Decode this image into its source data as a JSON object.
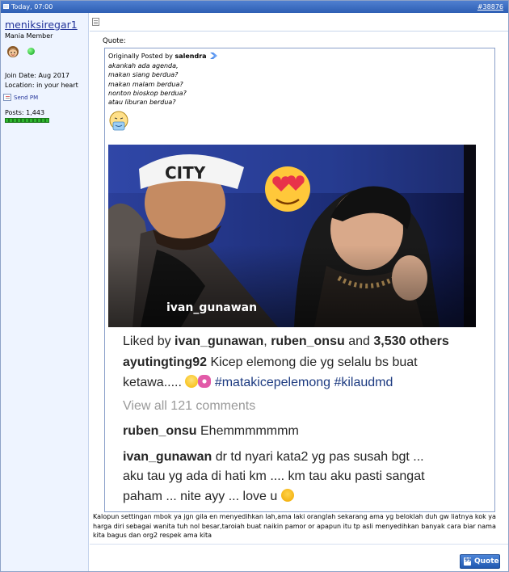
{
  "header": {
    "date": "Today, 07:00",
    "post_number": "#38876"
  },
  "user": {
    "name": "meniksiregar1",
    "title": "Mania Member",
    "join_date": "Join Date: Aug 2017",
    "location": "Location: in your heart",
    "send_pm": "Send PM",
    "posts": "Posts: 1,443",
    "reputation_pips": 11
  },
  "quote": {
    "label": "Quote:",
    "originally_posted_by": "Originally Posted by",
    "author": "salendra",
    "lines": [
      "akankah ada agenda,",
      "makan siang berdua?",
      "makan malam berdua?",
      "nonton bioskop berdua?",
      "atau liburan berdua?"
    ],
    "image": {
      "username_tag": "ivan_gunawan",
      "liked_by_prefix": "Liked by ",
      "liked_user1": "ivan_gunawan",
      "liked_sep": ", ",
      "liked_user2": "ruben_onsu",
      "liked_and": " and ",
      "liked_count": "3,530 others",
      "caption_user": "ayutingting92",
      "caption_text_1": " Kicep elemong die yg selalu bs buat",
      "caption_text_2": "ketawa.....",
      "caption_tags": "#matakicepelemong #kilaudmd",
      "view_all": "View all 121 comments",
      "comment1_user": "ruben_onsu",
      "comment1_text": " Ehemmmmmmm",
      "comment2_user": "ivan_gunawan",
      "comment2_text_1": " dr td nyari kata2 yg pas susah bgt ...",
      "comment2_text_2": "aku tau yg ada di hati km .... km tau aku pasti sangat",
      "comment2_text_3": "paham ... nite ayy ... love u"
    }
  },
  "post_text": "Kalopun settingan mbok ya jgn gila en menyedihkan lah,ama laki oranglah sekarang ama yg beloklah duh gw liatnya kok ya harga diri sebagai wanita tuh nol besar,taroiah buat naikin pamor or apapun itu tp asli menyedihkan banyak cara biar nama kita bagus dan org2 respek ama kita",
  "buttons": {
    "quote": "Quote"
  },
  "colors": {
    "header_bar": "#2e5fb4",
    "sidebar_bg": "#eef4ff",
    "username": "#23349a",
    "online": "#0a9a1a"
  }
}
